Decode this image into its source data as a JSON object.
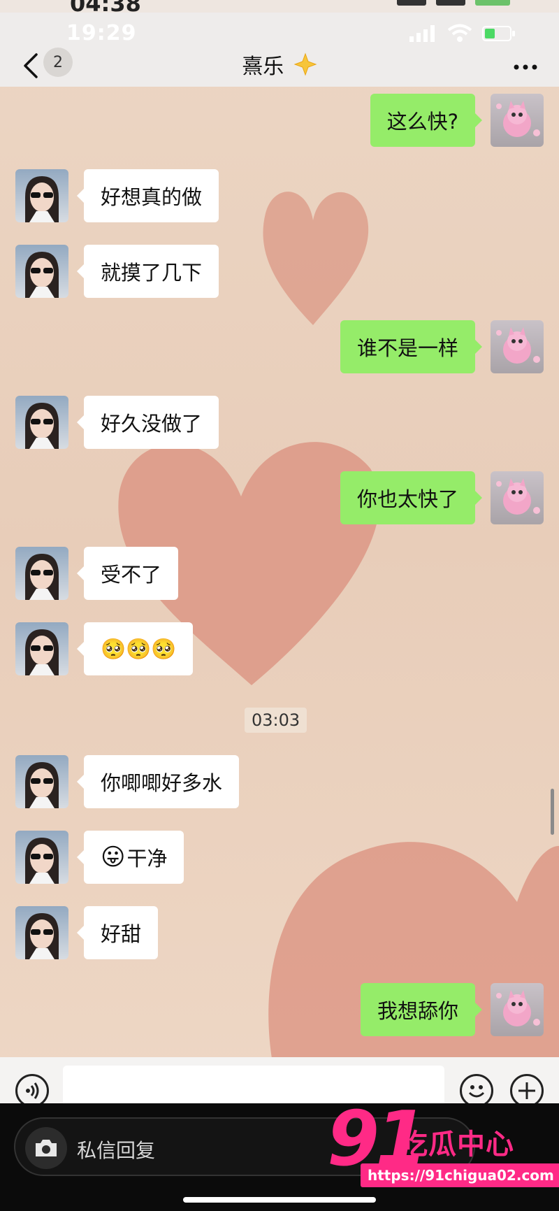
{
  "outer_status": {
    "time": "04:38"
  },
  "status_bar": {
    "time": "19:29"
  },
  "header": {
    "unread_count": "2",
    "title": "熹乐",
    "title_icon": "sparkle-star-emoji",
    "more_icon": "ellipsis-icon"
  },
  "messages": [
    {
      "side": "out",
      "text": "这么快?"
    },
    {
      "side": "in",
      "text": "好想真的做"
    },
    {
      "side": "in",
      "text": "就摸了几下"
    },
    {
      "side": "out",
      "text": "谁不是一样"
    },
    {
      "side": "in",
      "text": "好久没做了"
    },
    {
      "side": "out",
      "text": "你也太快了"
    },
    {
      "side": "in",
      "text": "受不了"
    },
    {
      "side": "in",
      "text": "🥺🥺🥺"
    },
    {
      "side": "in",
      "text": "你唧唧好多水"
    },
    {
      "side": "in",
      "emoji": "😛",
      "text": "干净"
    },
    {
      "side": "in",
      "text": "好甜"
    },
    {
      "side": "out",
      "text": "我想舔你"
    }
  ],
  "timestamp": "03:03",
  "input_bar": {
    "placeholder": ""
  },
  "bottom_bar": {
    "reply_label": "私信回复"
  },
  "watermark": {
    "number": "91",
    "name": "吃瓜中心",
    "url": "https://91chigua02.com"
  },
  "colors": {
    "outgoing_bubble": "#95ec69",
    "incoming_bubble": "#ffffff",
    "watermark": "#ff2a86",
    "heart": "#d98a78"
  }
}
